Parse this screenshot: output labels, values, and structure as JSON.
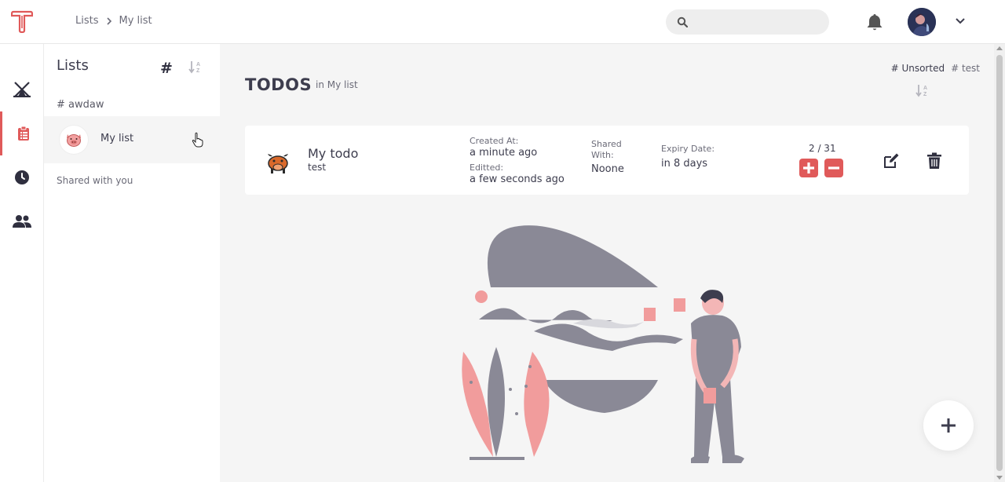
{
  "header": {
    "breadcrumb": [
      "Lists",
      "My list"
    ],
    "search": {
      "placeholder": "",
      "icon": "search-icon"
    },
    "icons": [
      "logo",
      "bell-icon",
      "avatar",
      "chevron-down-icon"
    ]
  },
  "rail": {
    "items": [
      {
        "name": "tent",
        "icon": "tent-icon",
        "active": false
      },
      {
        "name": "lists",
        "icon": "clipboard-list-icon",
        "active": true
      },
      {
        "name": "history",
        "icon": "clock-icon",
        "active": false
      },
      {
        "name": "users",
        "icon": "users-icon",
        "active": false
      }
    ]
  },
  "lists_panel": {
    "title": "Lists",
    "hash_button": "#",
    "tags": [
      "# awdaw"
    ],
    "lists": [
      {
        "name": "My list",
        "icon": "pig-icon"
      }
    ],
    "shared_label": "Shared with you"
  },
  "main": {
    "title": "TODOS",
    "subtitle": "in My list",
    "filters": [
      "# Unsorted",
      "# test"
    ],
    "todos": [
      {
        "name": "My todo",
        "tag": "test",
        "icon": "bull-icon",
        "created_label": "Created At:",
        "created_value": "a minute ago",
        "edited_label": "Editted:",
        "edited_value": "a few seconds ago",
        "shared_label": "Shared With:",
        "shared_value": "Noone",
        "expiry_label": "Expiry Date:",
        "expiry_value": "in 8 days",
        "count": "2 / 31"
      }
    ]
  },
  "colors": {
    "accent": "#e05a5a",
    "text": "#3d3d4e",
    "illustration_gray": "#8a8996",
    "illustration_pink": "#f19c9c",
    "background": "#f5f5f5"
  }
}
